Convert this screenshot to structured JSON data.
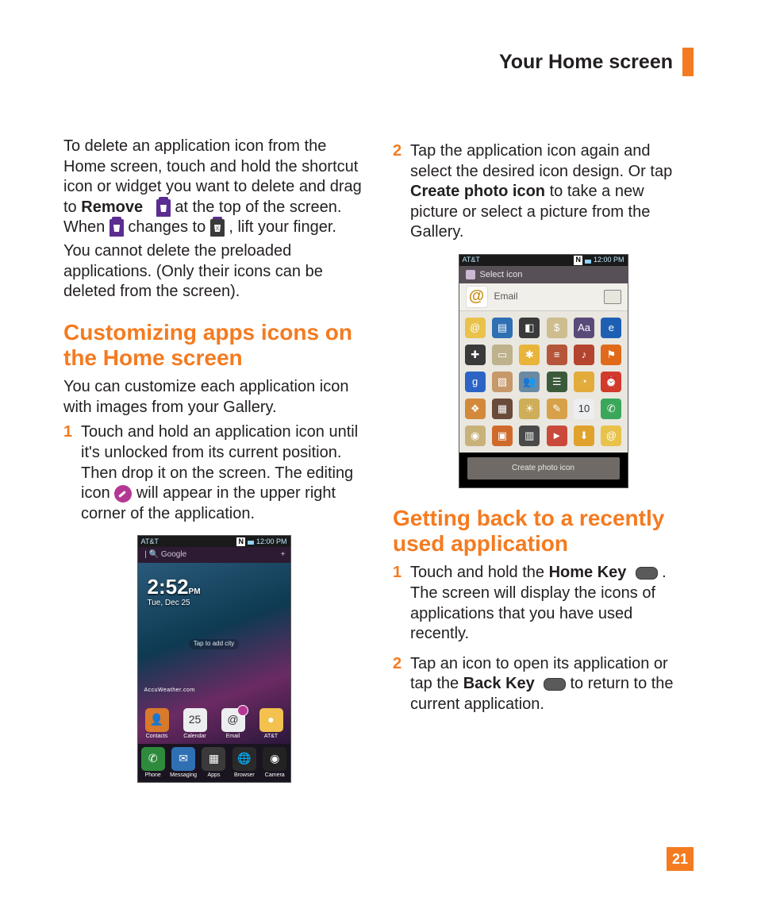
{
  "header": {
    "title": "Your Home screen"
  },
  "page_number": "21",
  "left": {
    "intro_parts": {
      "a": "To delete an application icon from the Home screen, touch and hold the shortcut icon or widget you want to delete and drag to ",
      "remove_bold": "Remove",
      "b": " at the top of the screen. When ",
      "c": " changes to ",
      "d": ", lift your finger.",
      "e": "You cannot delete the preloaded applications. (Only their icons can be deleted from the screen)."
    },
    "section_title": "Customizing apps icons on the Home screen",
    "section_intro": "You can customize each application icon with images from your Gallery.",
    "step1_parts": {
      "n": "1",
      "a": "Touch and hold an application icon until it's unlocked from its current position. Then drop it on the screen. The editing icon ",
      "b": " will appear in the upper right corner of the application."
    },
    "phone": {
      "carrier": "AT&T",
      "time": "12:00 PM",
      "nfc": "N",
      "search": "Google",
      "clock_time": "2:52",
      "clock_ampm": "PM",
      "clock_date": "Tue, Dec 25",
      "tap_hint": "Tap to add city",
      "accu": "AccuWeather.com",
      "row": [
        {
          "label": "Contacts",
          "glyph": "👤",
          "bg": "#d97a2b"
        },
        {
          "label": "Calendar",
          "glyph": "25",
          "bg": "#eceef0",
          "white": true
        },
        {
          "label": "Email",
          "glyph": "@",
          "bg": "#eceef0",
          "white": true,
          "edit": true
        },
        {
          "label": "AT&T",
          "glyph": "●",
          "bg": "#f2c14e"
        }
      ],
      "dock": [
        {
          "label": "Phone",
          "glyph": "✆",
          "bg": "#2e8b3d"
        },
        {
          "label": "Messaging",
          "glyph": "✉",
          "bg": "#2f6fb3"
        },
        {
          "label": "Apps",
          "glyph": "▦",
          "bg": "#3a3a3a"
        },
        {
          "label": "Browser",
          "glyph": "🌐",
          "bg": "#2a2a2a"
        },
        {
          "label": "Camera",
          "glyph": "◉",
          "bg": "#222"
        }
      ]
    }
  },
  "right": {
    "step2_parts": {
      "n": "2",
      "a": "Tap the application icon again and select the desired icon design. Or tap ",
      "bold": "Create photo icon",
      "b": " to take a new picture or select a picture from the Gallery."
    },
    "phone": {
      "carrier": "AT&T",
      "time": "12:00 PM",
      "nfc": "N",
      "title": "Select icon",
      "selected_label": "Email",
      "selected_glyph": "@",
      "grid": [
        {
          "g": "@",
          "bg": "#e8c24b"
        },
        {
          "g": "▤",
          "bg": "#2f6fb3"
        },
        {
          "g": "◧",
          "bg": "#3a3a3a"
        },
        {
          "g": "$",
          "bg": "#cdbd8f"
        },
        {
          "g": "Aa",
          "bg": "#5a4a7a"
        },
        {
          "g": "e",
          "bg": "#1e5fb3"
        },
        {
          "g": "✚",
          "bg": "#3a3a3a"
        },
        {
          "g": "▭",
          "bg": "#bdb28b"
        },
        {
          "g": "✱",
          "bg": "#e8b43a"
        },
        {
          "g": "≡",
          "bg": "#b5563a"
        },
        {
          "g": "♪",
          "bg": "#b4442e"
        },
        {
          "g": "⚑",
          "bg": "#e06a1a"
        },
        {
          "g": "g",
          "bg": "#2b64c4"
        },
        {
          "g": "▧",
          "bg": "#c7986a"
        },
        {
          "g": "👥",
          "bg": "#6a8aa3"
        },
        {
          "g": "☰",
          "bg": "#3b5a3a"
        },
        {
          "g": "◔",
          "bg": "#e2ab3a"
        },
        {
          "g": "⏰",
          "bg": "#d23a2c"
        },
        {
          "g": "❖",
          "bg": "#d28a3a"
        },
        {
          "g": "▦",
          "bg": "#6a4a3a"
        },
        {
          "g": "☀",
          "bg": "#cfae5a"
        },
        {
          "g": "✎",
          "bg": "#d7a14a"
        },
        {
          "g": "10",
          "bg": "#eceef0",
          "white": true
        },
        {
          "g": "✆",
          "bg": "#3aa85a"
        },
        {
          "g": "◉",
          "bg": "#c9b27a"
        },
        {
          "g": "▣",
          "bg": "#d06a2c"
        },
        {
          "g": "▥",
          "bg": "#4a4a4a"
        },
        {
          "g": "►",
          "bg": "#c94a3a"
        },
        {
          "g": "⬇",
          "bg": "#e0a22c"
        },
        {
          "g": "@",
          "bg": "#e8c24b"
        }
      ],
      "button": "Create photo icon"
    },
    "section_title": "Getting back to a recently used application",
    "step1_parts": {
      "n": "1",
      "a": "Touch and hold the ",
      "bold": "Home Key",
      "b": ". The screen will display the icons of applications that you have used recently."
    },
    "step2b_parts": {
      "n": "2",
      "a": "Tap an icon to open its application or tap the ",
      "bold": "Back Key",
      "b": " to return to the current application."
    }
  }
}
